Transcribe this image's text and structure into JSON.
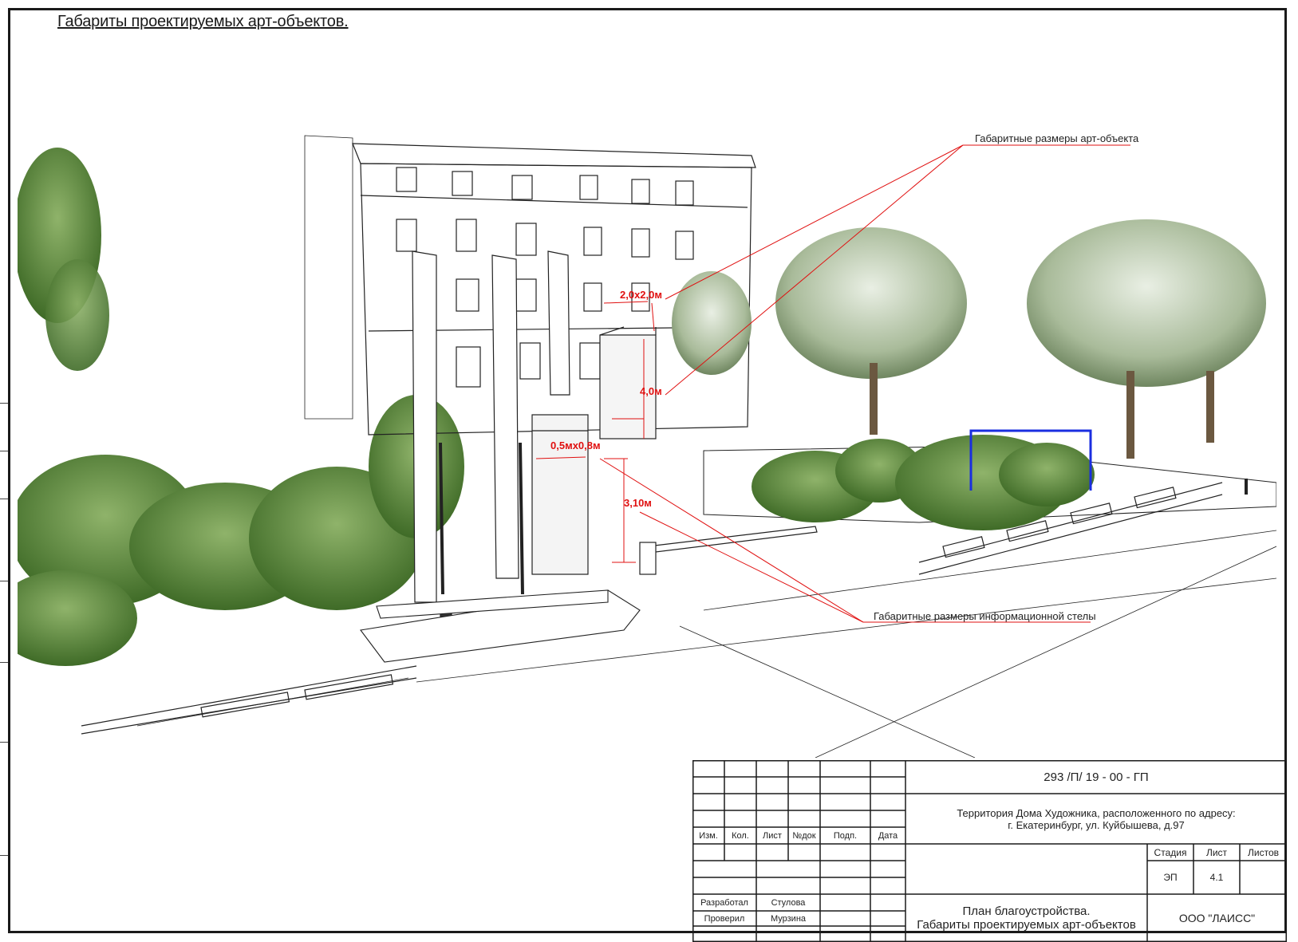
{
  "sheet_title": "Габариты проектируемых арт-объектов.",
  "callouts": {
    "art_object": "Габаритные размеры арт-объекта",
    "info_stele": "Габаритные размеры информационной стелы"
  },
  "dimensions": {
    "art_object_plan": "2,0х2,0м",
    "art_object_height": "4,0м",
    "stele_plan": "0,5мх0,8м",
    "stele_height": "3,10м"
  },
  "colors": {
    "annotation_red": "#e01010",
    "foliage_green": "#5e8a3a",
    "highlight_blue": "#1a2ee0",
    "line": "#222222"
  },
  "title_block": {
    "document_code": "293 /П/ 19 - 00 - ГП",
    "object_line1": "Территория Дома Художника, расположенного по адресу:",
    "object_line2": "г. Екатеринбург, ул. Куйбышева, д.97",
    "headers": {
      "izm": "Изм.",
      "kol": "Кол.",
      "list": "Лист",
      "ndok": "№док",
      "podp": "Подп.",
      "data": "Дата"
    },
    "stage_label": "Стадия",
    "sheet_label": "Лист",
    "sheets_label": "Листов",
    "stage_value": "ЭП",
    "sheet_value": "4.1",
    "sheets_value": "",
    "developed_label": "Разработал",
    "developed_name": "Стулова",
    "checked_label": "Проверил",
    "checked_name": "Мурзина",
    "drawing_line1": "План благоустройства.",
    "drawing_line2": "Габариты проектируемых арт-объектов",
    "company": "ООО \"ЛАИСС\""
  }
}
